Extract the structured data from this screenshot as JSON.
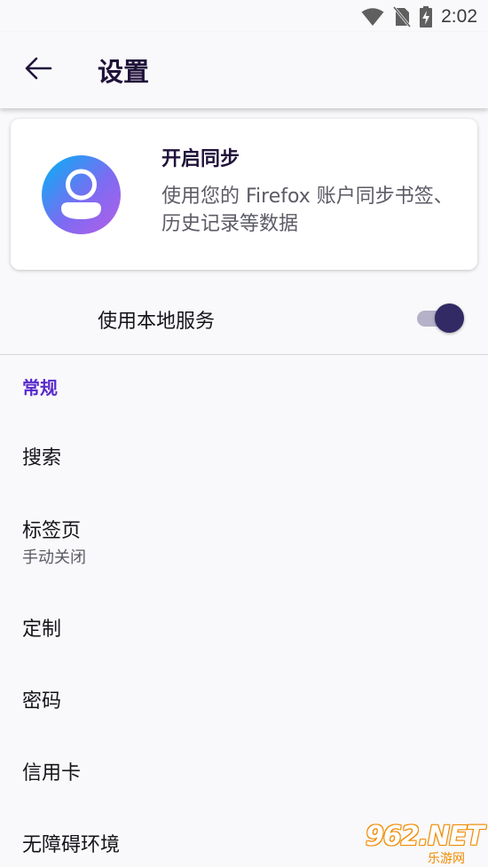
{
  "status_bar": {
    "time": "2:02",
    "icons": [
      "wifi-icon",
      "no-sim-icon",
      "battery-charging-icon"
    ]
  },
  "app_bar": {
    "back_icon": "arrow-left-icon",
    "title": "设置"
  },
  "sync_card": {
    "avatar_icon": "account-avatar-icon",
    "title": "开启同步",
    "description": "使用您的 Firefox 账户同步书签、历史记录等数据",
    "colors": {
      "avatar_gradient": [
        "#00b3f4",
        "#7b6cf2",
        "#b55ee6"
      ]
    }
  },
  "local_service": {
    "label": "使用本地服务",
    "enabled": true,
    "colors": {
      "thumb": "#312a65",
      "track": "#b5b1c8"
    }
  },
  "general_section": {
    "header": "常规",
    "header_color": "#592acb",
    "items": [
      {
        "label": "搜索",
        "sublabel": ""
      },
      {
        "label": "标签页",
        "sublabel": "手动关闭"
      },
      {
        "label": "定制",
        "sublabel": ""
      },
      {
        "label": "密码",
        "sublabel": ""
      },
      {
        "label": "信用卡",
        "sublabel": ""
      },
      {
        "label": "无障碍环境",
        "sublabel": ""
      }
    ]
  },
  "watermark": {
    "main": "962.NET",
    "sub": "乐游网"
  }
}
